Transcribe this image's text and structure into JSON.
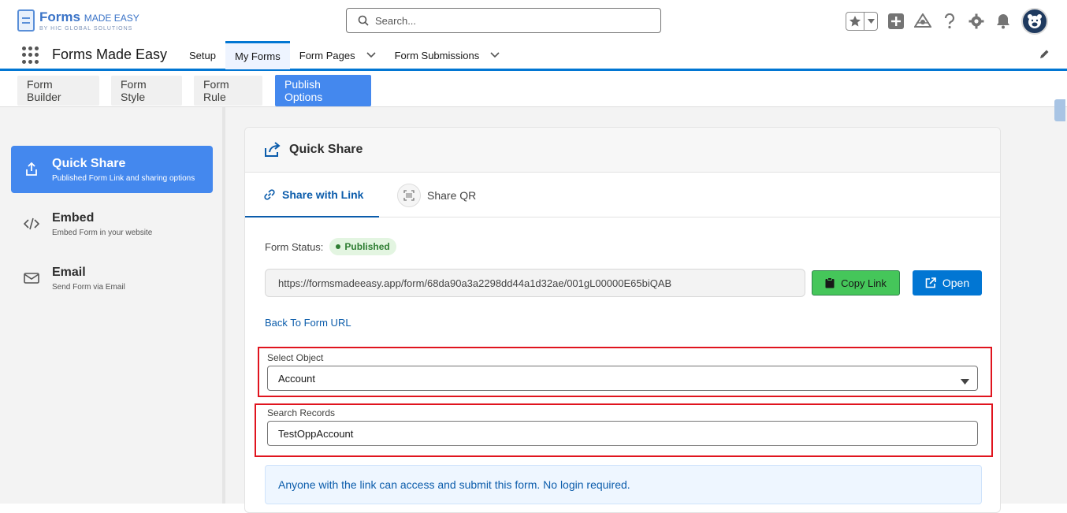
{
  "header": {
    "logo_title": "Forms",
    "logo_title_suffix": "MADE EASY",
    "logo_subtitle": "BY HIC GLOBAL SOLUTIONS",
    "search_placeholder": "Search..."
  },
  "nav": {
    "app_name": "Forms Made Easy",
    "items": [
      {
        "label": "Setup"
      },
      {
        "label": "My Forms"
      },
      {
        "label": "Form Pages"
      },
      {
        "label": "Form Submissions"
      }
    ]
  },
  "sub_tabs": [
    {
      "label": "Form Builder"
    },
    {
      "label": "Form Style"
    },
    {
      "label": "Form Rule"
    },
    {
      "label": "Publish Options"
    }
  ],
  "sidebar": {
    "items": [
      {
        "title": "Quick Share",
        "subtitle": "Published Form Link and sharing options",
        "icon": "share-upload-icon"
      },
      {
        "title": "Embed",
        "subtitle": "Embed Form in your website",
        "icon": "code-icon"
      },
      {
        "title": "Email",
        "subtitle": "Send Form via Email",
        "icon": "envelope-icon"
      }
    ]
  },
  "card": {
    "title": "Quick Share",
    "tabs": [
      {
        "label": "Share with Link"
      },
      {
        "label": "Share QR"
      }
    ],
    "status_label": "Form Status:",
    "status_value": "Published",
    "url": "https://formsmadeeasy.app/form/68da90a3a2298dd44a1d32ae/001gL00000E65biQAB",
    "copy_label": "Copy Link",
    "open_label": "Open",
    "back_link": "Back To Form URL",
    "select_object_label": "Select Object",
    "select_object_value": "Account",
    "search_records_label": "Search Records",
    "search_records_value": "TestOppAccount",
    "info_text": "Anyone with the link can access and submit this form. No login required."
  },
  "colors": {
    "brand_blue": "#0176d3",
    "active_tab": "#4488ee",
    "copy_green": "#45c65a",
    "highlight_red": "#e0141e"
  }
}
